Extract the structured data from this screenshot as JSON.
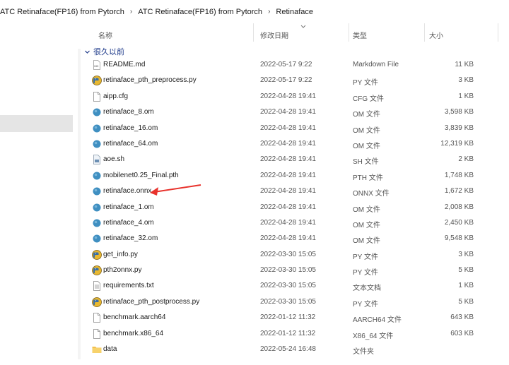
{
  "breadcrumb": {
    "items": [
      "ATC Retinaface(FP16) from Pytorch",
      "ATC Retinaface(FP16) from Pytorch",
      "Retinaface"
    ],
    "separator": "›"
  },
  "columns": {
    "name": "名称",
    "date": "修改日期",
    "type": "类型",
    "size": "大小"
  },
  "group": {
    "label": "很久以前"
  },
  "files": [
    {
      "name": "README.md",
      "date": "2022-05-17 9:22",
      "type": "Markdown File",
      "size": "11 KB",
      "icon": "markdown-file-icon"
    },
    {
      "name": "retinaface_pth_preprocess.py",
      "date": "2022-05-17 9:22",
      "type": "PY 文件",
      "size": "3 KB",
      "icon": "python-file-icon"
    },
    {
      "name": "aipp.cfg",
      "date": "2022-04-28 19:41",
      "type": "CFG 文件",
      "size": "1 KB",
      "icon": "generic-file-icon"
    },
    {
      "name": "retinaface_8.om",
      "date": "2022-04-28 19:41",
      "type": "OM 文件",
      "size": "3,598 KB",
      "icon": "om-file-icon"
    },
    {
      "name": "retinaface_16.om",
      "date": "2022-04-28 19:41",
      "type": "OM 文件",
      "size": "3,839 KB",
      "icon": "om-file-icon"
    },
    {
      "name": "retinaface_64.om",
      "date": "2022-04-28 19:41",
      "type": "OM 文件",
      "size": "12,319 KB",
      "icon": "om-file-icon"
    },
    {
      "name": "aoe.sh",
      "date": "2022-04-28 19:41",
      "type": "SH 文件",
      "size": "2 KB",
      "icon": "shell-script-icon"
    },
    {
      "name": "mobilenet0.25_Final.pth",
      "date": "2022-04-28 19:41",
      "type": "PTH 文件",
      "size": "1,748 KB",
      "icon": "pth-file-icon"
    },
    {
      "name": "retinaface.onnx",
      "date": "2022-04-28 19:41",
      "type": "ONNX 文件",
      "size": "1,672 KB",
      "icon": "onnx-file-icon"
    },
    {
      "name": "retinaface_1.om",
      "date": "2022-04-28 19:41",
      "type": "OM 文件",
      "size": "2,008 KB",
      "icon": "om-file-icon"
    },
    {
      "name": "retinaface_4.om",
      "date": "2022-04-28 19:41",
      "type": "OM 文件",
      "size": "2,450 KB",
      "icon": "om-file-icon"
    },
    {
      "name": "retinaface_32.om",
      "date": "2022-04-28 19:41",
      "type": "OM 文件",
      "size": "9,548 KB",
      "icon": "om-file-icon"
    },
    {
      "name": "get_info.py",
      "date": "2022-03-30 15:05",
      "type": "PY 文件",
      "size": "3 KB",
      "icon": "python-file-icon"
    },
    {
      "name": "pth2onnx.py",
      "date": "2022-03-30 15:05",
      "type": "PY 文件",
      "size": "5 KB",
      "icon": "python-file-icon"
    },
    {
      "name": "requirements.txt",
      "date": "2022-03-30 15:05",
      "type": "文本文档",
      "size": "1 KB",
      "icon": "text-file-icon"
    },
    {
      "name": "retinaface_pth_postprocess.py",
      "date": "2022-03-30 15:05",
      "type": "PY 文件",
      "size": "5 KB",
      "icon": "python-file-icon"
    },
    {
      "name": "benchmark.aarch64",
      "date": "2022-01-12 11:32",
      "type": "AARCH64 文件",
      "size": "643 KB",
      "icon": "generic-file-icon"
    },
    {
      "name": "benchmark.x86_64",
      "date": "2022-01-12 11:32",
      "type": "X86_64 文件",
      "size": "603 KB",
      "icon": "generic-file-icon"
    },
    {
      "name": "data",
      "date": "2022-05-24 16:48",
      "type": "文件夹",
      "size": "",
      "icon": "folder-icon"
    }
  ],
  "colors": {
    "om": "#3f8fc1",
    "python_yellow": "#e8b830",
    "python_blue": "#3a6ea5",
    "folder": "#f3c04d",
    "arrow": "#e8322c",
    "group_text": "#1e3a8a"
  }
}
